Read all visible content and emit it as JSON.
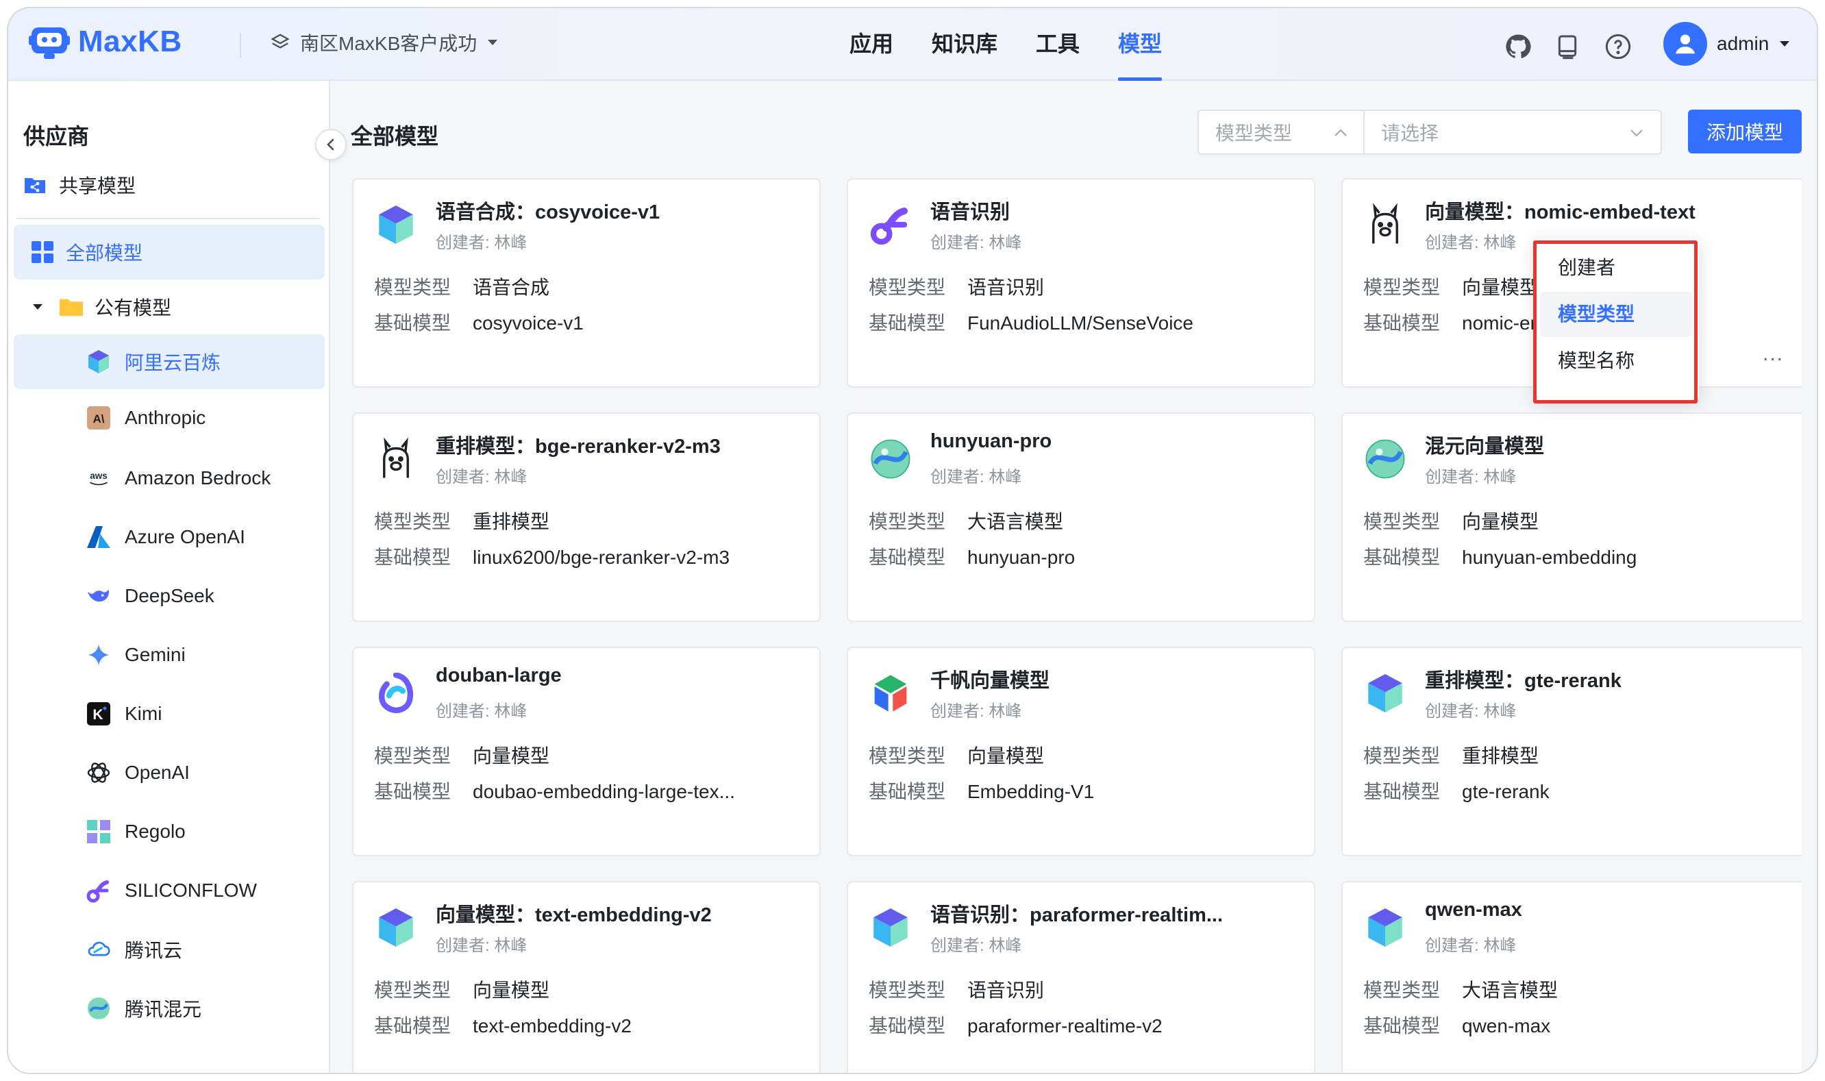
{
  "app": {
    "name": "MaxKB",
    "workspace": "南区MaxKB客户成功"
  },
  "nav": {
    "items": [
      "应用",
      "知识库",
      "工具",
      "模型"
    ],
    "active": "模型"
  },
  "user": {
    "name": "admin"
  },
  "sidebar": {
    "title": "供应商",
    "shared": "共享模型",
    "all_models": "全部模型",
    "public_group": "公有模型",
    "providers": [
      "阿里云百炼",
      "Anthropic",
      "Amazon Bedrock",
      "Azure OpenAI",
      "DeepSeek",
      "Gemini",
      "Kimi",
      "OpenAI",
      "Regolo",
      "SILICONFLOW",
      "腾讯云",
      "腾讯混元"
    ],
    "active_provider": "阿里云百炼"
  },
  "main": {
    "title": "全部模型",
    "filter_type_placeholder": "模型类型",
    "filter_select_placeholder": "请选择",
    "add_button": "添加模型",
    "labels": {
      "type": "模型类型",
      "base": "基础模型"
    }
  },
  "dropdown": {
    "options": [
      "创建者",
      "模型类型",
      "模型名称"
    ],
    "selected": "模型类型"
  },
  "cards": [
    {
      "name": "语音合成：cosyvoice-v1",
      "creator": "创建者: 林峰",
      "type": "语音合成",
      "base": "cosyvoice-v1",
      "icon": "bailian-icon"
    },
    {
      "name": "语音识别",
      "creator": "创建者: 林峰",
      "type": "语音识别",
      "base": "FunAudioLLM/SenseVoice",
      "icon": "siliconflow-icon"
    },
    {
      "name": "向量模型：nomic-embed-text",
      "creator": "创建者: 林峰",
      "type": "向量模型",
      "base": "nomic-embed-text",
      "icon": "ollama-icon",
      "more": "..."
    },
    {
      "name": "重排模型：bge-reranker-v2-m3",
      "creator": "创建者: 林峰",
      "type": "重排模型",
      "base": "linux6200/bge-reranker-v2-m3",
      "icon": "ollama-icon"
    },
    {
      "name": "hunyuan-pro",
      "creator": "创建者: 林峰",
      "type": "大语言模型",
      "base": "hunyuan-pro",
      "icon": "hunyuan-icon"
    },
    {
      "name": "混元向量模型",
      "creator": "创建者: 林峰",
      "type": "向量模型",
      "base": "hunyuan-embedding",
      "icon": "hunyuan-icon"
    },
    {
      "name": "douban-large",
      "creator": "创建者: 林峰",
      "type": "向量模型",
      "base": "doubao-embedding-large-tex...",
      "icon": "doubao-icon"
    },
    {
      "name": "千帆向量模型",
      "creator": "创建者: 林峰",
      "type": "向量模型",
      "base": "Embedding-V1",
      "icon": "qianfan-icon"
    },
    {
      "name": "重排模型：gte-rerank",
      "creator": "创建者: 林峰",
      "type": "重排模型",
      "base": "gte-rerank",
      "icon": "bailian-icon"
    },
    {
      "name": "向量模型：text-embedding-v2",
      "creator": "创建者: 林峰",
      "type": "向量模型",
      "base": "text-embedding-v2",
      "icon": "bailian-icon"
    },
    {
      "name": "语音识别：paraformer-realtim...",
      "creator": "创建者: 林峰",
      "type": "语音识别",
      "base": "paraformer-realtime-v2",
      "icon": "bailian-icon"
    },
    {
      "name": "qwen-max",
      "creator": "创建者: 林峰",
      "type": "大语言模型",
      "base": "qwen-max",
      "icon": "bailian-icon"
    }
  ],
  "colors": {
    "accent": "#3370ff",
    "highlight": "#e5372d"
  }
}
